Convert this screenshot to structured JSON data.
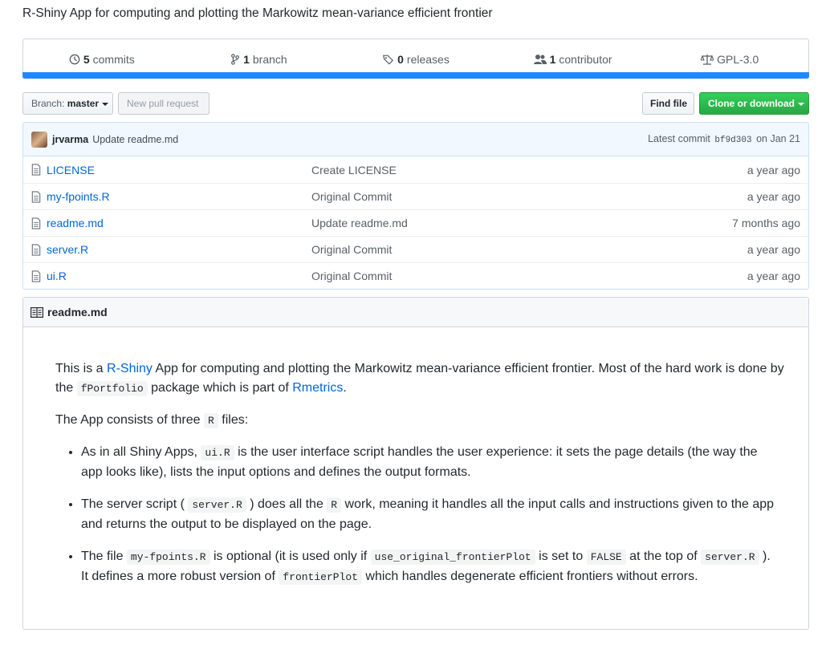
{
  "description": "R-Shiny App for computing and plotting the Markowitz mean-variance efficient frontier",
  "summary": {
    "commits_count": "5",
    "commits_label": "commits",
    "branch_count": "1",
    "branch_label": "branch",
    "releases_count": "0",
    "releases_label": "releases",
    "contributor_count": "1",
    "contributor_label": "contributor",
    "license": "GPL-3.0"
  },
  "toolbar": {
    "branch_label": "Branch:",
    "branch_value": "master",
    "pull_request": "New pull request",
    "find_file": "Find file",
    "clone": "Clone or download"
  },
  "commit": {
    "author": "jrvarma",
    "message": "Update readme.md",
    "latest_label": "Latest commit",
    "sha": "bf9d303",
    "date": "on Jan 21"
  },
  "files": [
    {
      "name": "LICENSE",
      "message": "Create LICENSE",
      "age": "a year ago"
    },
    {
      "name": "my-fpoints.R",
      "message": "Original Commit",
      "age": "a year ago"
    },
    {
      "name": "readme.md",
      "message": "Update readme.md",
      "age": "7 months ago"
    },
    {
      "name": "server.R",
      "message": "Original Commit",
      "age": "a year ago"
    },
    {
      "name": "ui.R",
      "message": "Original Commit",
      "age": "a year ago"
    }
  ],
  "readme": {
    "title": "readme.md",
    "p1": {
      "t1": "This is a ",
      "link1": "R-Shiny",
      "t2": " App for computing and plotting the Markowitz mean-variance efficient frontier. Most of the hard work is done by the ",
      "code1": "fPortfolio",
      "t3": " package which is part of ",
      "link2": "Rmetrics",
      "t4": "."
    },
    "p2": {
      "t1": "The App consists of three ",
      "code1": "R",
      "t2": " files:"
    },
    "li1": {
      "t1": "As in all Shiny Apps, ",
      "code1": "ui.R",
      "t2": " is the user interface script handles the user experience: it sets the page details (the way the app looks like), lists the input options and defines the output formats."
    },
    "li2": {
      "t1": "The server script ( ",
      "code1": "server.R",
      "t2": " ) does all the ",
      "code2": "R",
      "t3": " work, meaning it handles all the input calls and instructions given to the app and returns the output to be displayed on the page."
    },
    "li3": {
      "t1": "The file ",
      "code1": "my-fpoints.R",
      "t2": " is optional (it is used only if ",
      "code2": "use_original_frontierPlot",
      "t3": " is set to ",
      "code3": "FALSE",
      "t4": " at the top of ",
      "code4": "server.R",
      "t5": " ). It defines a more robust version of ",
      "code5": "frontierPlot",
      "t6": " which handles degenerate efficient frontiers without errors."
    }
  }
}
